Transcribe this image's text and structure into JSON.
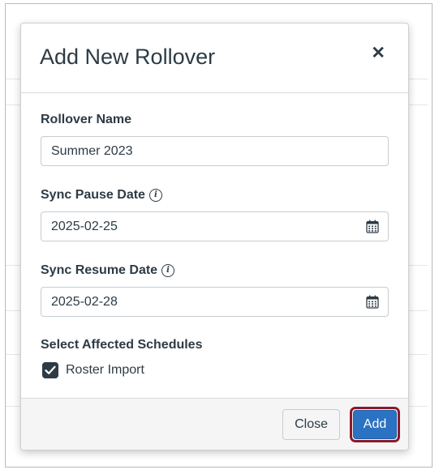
{
  "dialog": {
    "title": "Add New Rollover",
    "close_icon": "close-icon"
  },
  "form": {
    "rollover_name": {
      "label": "Rollover Name",
      "value": "Summer 2023"
    },
    "sync_pause_date": {
      "label": "Sync Pause Date",
      "value": "2025-02-25",
      "info_icon": "info-icon",
      "calendar_icon": "calendar-icon"
    },
    "sync_resume_date": {
      "label": "Sync Resume Date",
      "value": "2025-02-28",
      "info_icon": "info-icon",
      "calendar_icon": "calendar-icon"
    },
    "affected_schedules": {
      "label": "Select Affected Schedules",
      "options": [
        {
          "label": "Roster Import",
          "checked": true
        }
      ]
    }
  },
  "footer": {
    "close_label": "Close",
    "add_label": "Add"
  },
  "colors": {
    "text": "#2d3b45",
    "primary": "#2b72c2",
    "highlight_outline": "#8b1a2b"
  }
}
